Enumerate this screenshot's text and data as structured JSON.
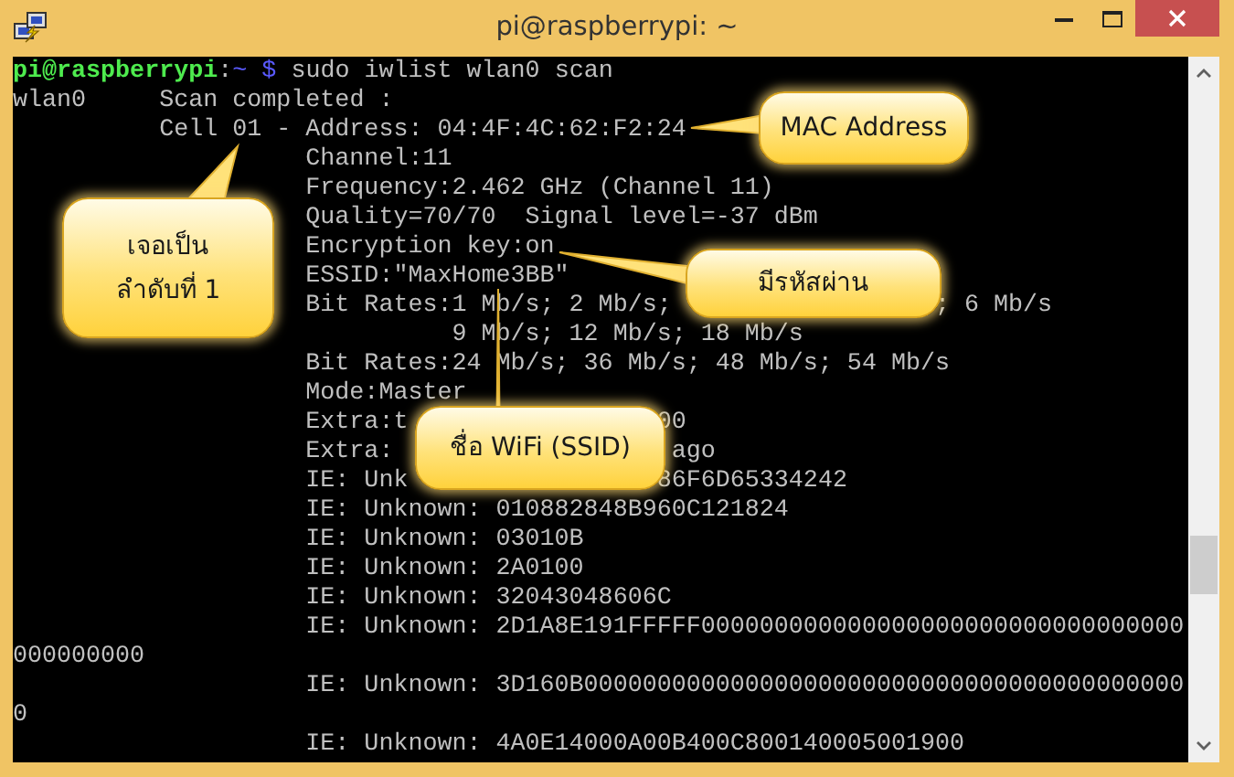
{
  "window": {
    "title": "pi@raspberrypi: ~"
  },
  "terminal": {
    "lines": [
      {
        "kind": "prompt",
        "user": "pi@raspberrypi",
        "separator": ":",
        "path": "~",
        "symbol": "$",
        "command": "sudo iwlist wlan0 scan"
      },
      {
        "kind": "output",
        "text": "wlan0     Scan completed :"
      },
      {
        "kind": "output",
        "text": "          Cell 01 - Address: 04:4F:4C:62:F2:24"
      },
      {
        "kind": "output",
        "text": "                    Channel:11"
      },
      {
        "kind": "output",
        "text": "                    Frequency:2.462 GHz (Channel 11)"
      },
      {
        "kind": "output",
        "text": "                    Quality=70/70  Signal level=-37 dBm"
      },
      {
        "kind": "output",
        "text": "                    Encryption key:on"
      },
      {
        "kind": "output",
        "text": "                    ESSID:\"MaxHome3BB\""
      },
      {
        "kind": "output",
        "text": "                    Bit Rates:1 Mb/s; 2 Mb/s;                  ; 6 Mb/s"
      },
      {
        "kind": "output",
        "text": "                              9 Mb/s; 12 Mb/s; 18 Mb/s"
      },
      {
        "kind": "output",
        "text": "                    Bit Rates:24 Mb/s; 36 Mb/s; 48 Mb/s; 54 Mb/s"
      },
      {
        "kind": "output",
        "text": "                    Mode:Master"
      },
      {
        "kind": "output",
        "text": "                    Extra:t                 00"
      },
      {
        "kind": "output",
        "text": "                    Extra:                   ago"
      },
      {
        "kind": "output",
        "text": "                    IE: Unk                 86F6D65334242"
      },
      {
        "kind": "output",
        "text": "                    IE: Unknown: 010882848B960C121824"
      },
      {
        "kind": "output",
        "text": "                    IE: Unknown: 03010B"
      },
      {
        "kind": "output",
        "text": "                    IE: Unknown: 2A0100"
      },
      {
        "kind": "output",
        "text": "                    IE: Unknown: 32043048606C"
      },
      {
        "kind": "output",
        "text": "                    IE: Unknown: 2D1A8E191FFFFF000000000000000000000000000000000"
      },
      {
        "kind": "output",
        "text": "000000000"
      },
      {
        "kind": "output",
        "text": "                    IE: Unknown: 3D160B00000000000000000000000000000000000000000"
      },
      {
        "kind": "output",
        "text": "0"
      },
      {
        "kind": "output",
        "text": "                    IE: Unknown: 4A0E14000A00B400C800140005001900"
      }
    ]
  },
  "callouts": [
    {
      "lines": [
        "MAC Address"
      ]
    },
    {
      "lines": [
        "เจอเป็น",
        "ลำดับที่ 1"
      ]
    },
    {
      "lines": [
        "มีรหัสผ่าน"
      ]
    },
    {
      "lines": [
        "ชื่อ WiFi (SSID)"
      ]
    }
  ]
}
